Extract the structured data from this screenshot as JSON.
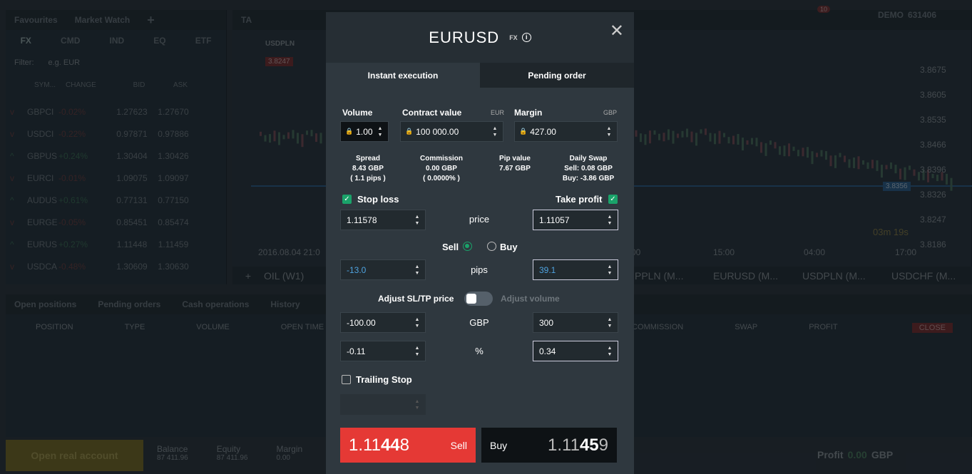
{
  "background": {
    "left_tabs": [
      "Favourites",
      "Market Watch"
    ],
    "categories": [
      "FX",
      "CMD",
      "IND",
      "EQ",
      "ETF"
    ],
    "filter_label": "Filter:",
    "filter_placeholder": "e.g. EUR",
    "columns": [
      "SYM...",
      "CHANGE",
      "BID",
      "ASK"
    ],
    "rows": [
      {
        "sym": "GBPCI",
        "change": "-0.02%",
        "bid": "1.27623",
        "ask": "1.27670"
      },
      {
        "sym": "USDCI",
        "change": "-0.22%",
        "bid": "0.97871",
        "ask": "0.97886"
      },
      {
        "sym": "GBPUS",
        "change": "+0.24%",
        "bid": "1.30404",
        "ask": "1.30426"
      },
      {
        "sym": "EURCI",
        "change": "-0.01%",
        "bid": "1.09075",
        "ask": "1.09097"
      },
      {
        "sym": "AUDUS",
        "change": "+0.61%",
        "bid": "0.77131",
        "ask": "0.77150"
      },
      {
        "sym": "EURGE",
        "change": "-0.05%",
        "bid": "0.85451",
        "ask": "0.85474"
      },
      {
        "sym": "EURUS",
        "change": "+0.27%",
        "bid": "1.11448",
        "ask": "1.11459"
      },
      {
        "sym": "USDCA",
        "change": "-0.48%",
        "bid": "1.30609",
        "ask": "1.30630"
      }
    ],
    "chart_tab": "TA",
    "chart_symbol": "USDPLN",
    "chart_price": "3.8247",
    "chart_date": "2016.08.04 21:0",
    "y_ticks": [
      "3.8675",
      "3.8605",
      "3.8535",
      "3.8466",
      "3.8396",
      "3.8326",
      "3.8247",
      "3.8186"
    ],
    "x_ticks": [
      "00",
      "15:00",
      "04:00",
      "17:00"
    ],
    "line_price": "3.8356",
    "timer": "03m 19s",
    "bottom_tabs": [
      "OIL (W1)",
      "PPLN (M...",
      "EURUSD (M...",
      "USDPLN (M...",
      "USDCHF (M..."
    ],
    "positions_tabs": [
      "Open positions",
      "Pending orders",
      "Cash operations",
      "History"
    ],
    "positions_cols": [
      "POSITION",
      "TYPE",
      "VOLUME",
      "OPEN TIME",
      "COMMISSION",
      "SWAP",
      "PROFIT"
    ],
    "close_label": "CLOSE",
    "account_button": "Open real account",
    "footer_labels": [
      "Balance",
      "Equity",
      "Margin"
    ],
    "footer_values": [
      "87 411.96",
      "87 411.96",
      "0.00"
    ],
    "profit_label": "Profit",
    "profit_value": "0.00",
    "profit_currency": "GBP",
    "account_type": "DEMO",
    "account_number": "631406",
    "notifications": "10"
  },
  "modal": {
    "symbol": "EURUSD",
    "tag": "FX",
    "tabs": [
      "Instant execution",
      "Pending order"
    ],
    "volume_label": "Volume",
    "volume": "1.00",
    "contract_label": "Contract value",
    "contract_currency": "EUR",
    "contract_value": "100 000.00",
    "margin_label": "Margin",
    "margin_currency": "GBP",
    "margin_value": "427.00",
    "spread_label": "Spread",
    "spread_value": "8.43 GBP",
    "spread_pips": "( 1.1 pips )",
    "commission_label": "Commission",
    "commission_value": "0.00 GBP",
    "commission_pct": "( 0.0000% )",
    "pip_label": "Pip value",
    "pip_value": "7.67 GBP",
    "swap_label": "Daily Swap",
    "swap_sell": "Sell: 0.08 GBP",
    "swap_buy": "Buy: -3.86 GBP",
    "stop_loss_label": "Stop loss",
    "take_profit_label": "Take profit",
    "sl_price": "1.11578",
    "price_label": "price",
    "tp_price": "1.11057",
    "sell_label": "Sell",
    "buy_label": "Buy",
    "sl_pips": "-13.0",
    "pips_label": "pips",
    "tp_pips": "39.1",
    "adjust_label": "Adjust SL/TP price",
    "adjust_volume_label": "Adjust volume",
    "sl_gbp": "-100.00",
    "gbp_label": "GBP",
    "tp_gbp": "300",
    "sl_pct": "-0.11",
    "pct_label": "%",
    "tp_pct": "0.34",
    "trailing_label": "Trailing Stop",
    "sell_price_a": "1.11",
    "sell_price_b": "44",
    "sell_price_c": "8",
    "sell_button": "Sell",
    "buy_button": "Buy",
    "buy_price_a": "1.11",
    "buy_price_b": "45",
    "buy_price_c": "9",
    "colors": {
      "sell": "#e53935",
      "buy": "#0e1215",
      "check": "#1aa36a",
      "pips_text": "#4fa3e0"
    }
  }
}
